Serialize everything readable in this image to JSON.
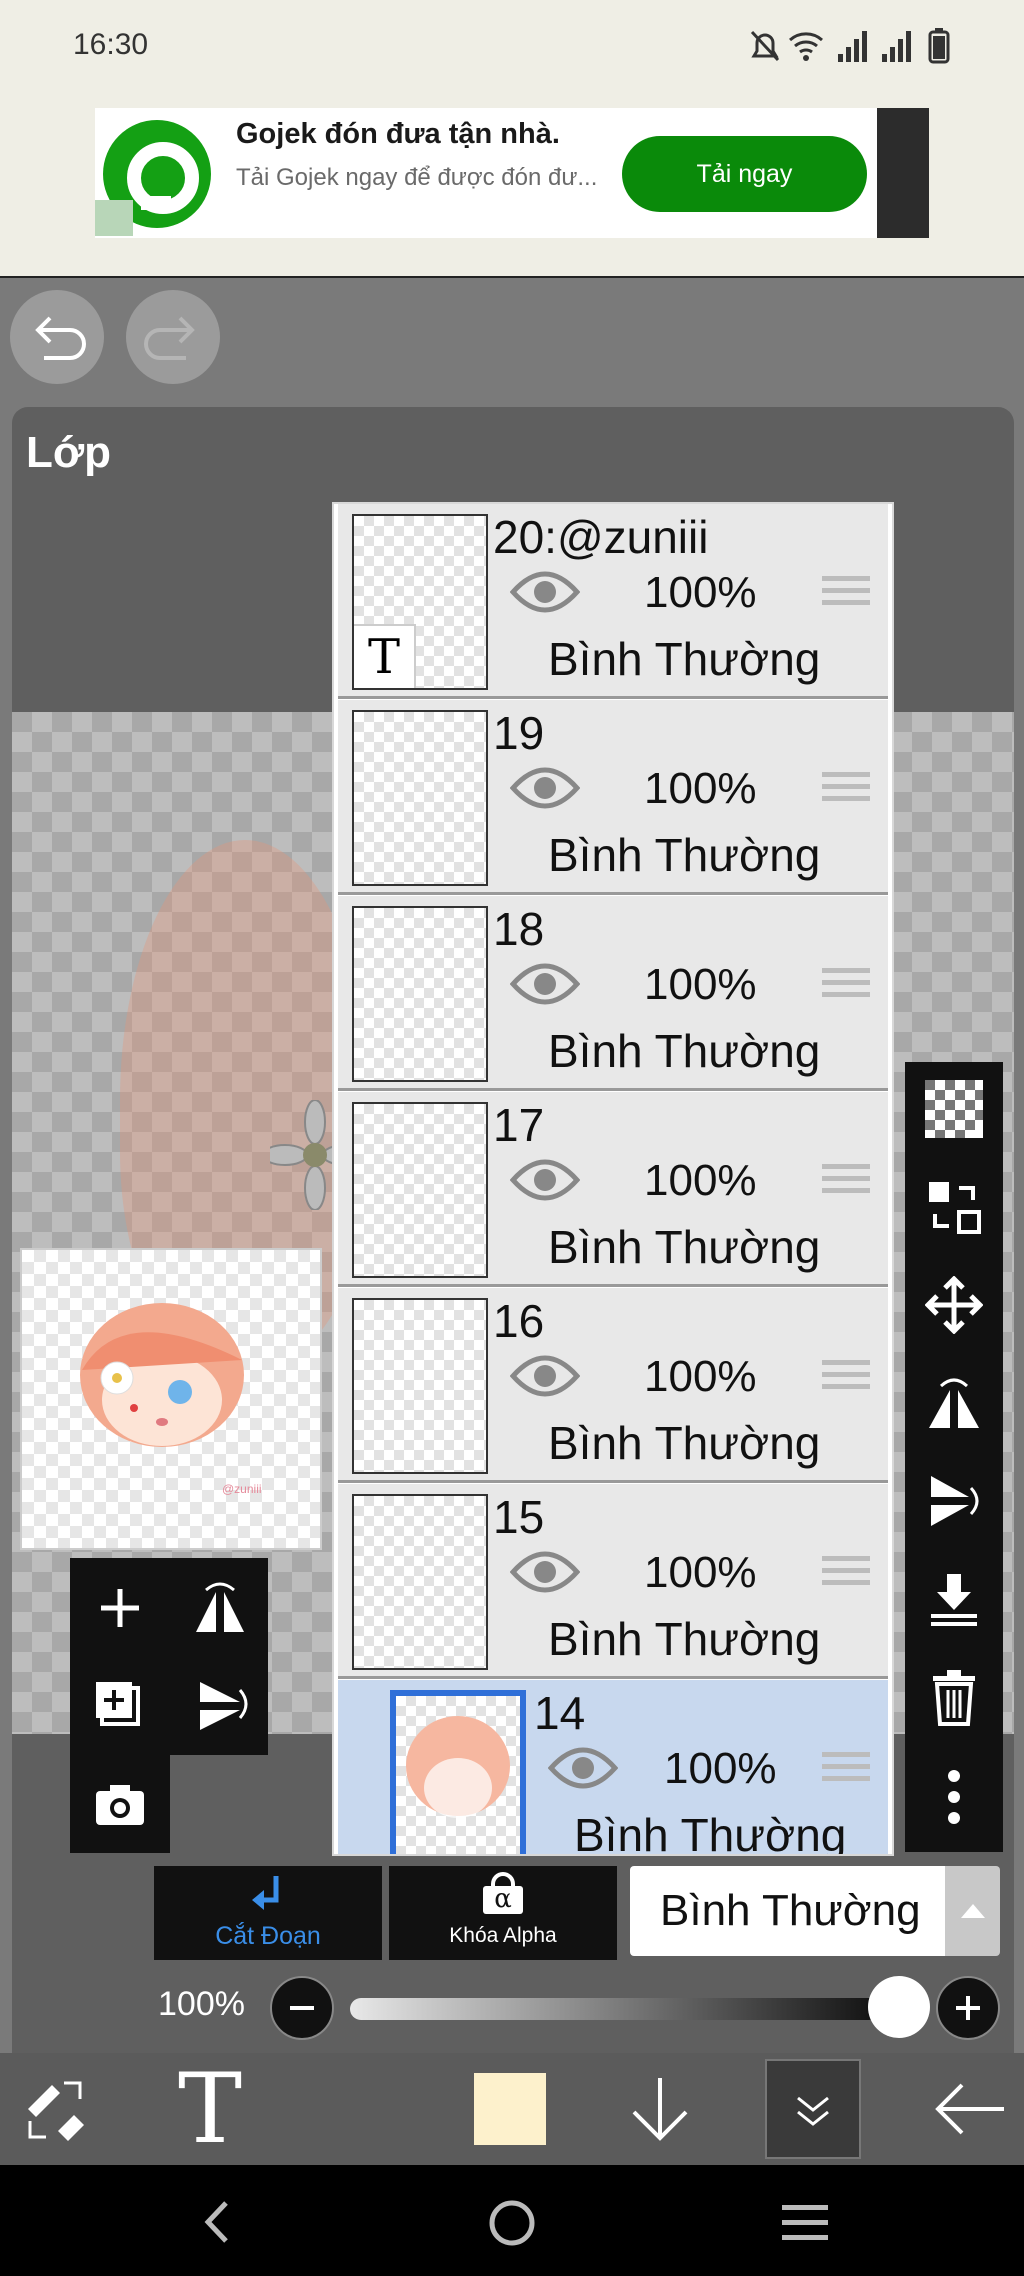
{
  "status": {
    "time": "16:30",
    "icons": [
      "bell-off-icon",
      "wifi-icon",
      "signal-icon",
      "signal-icon",
      "battery-icon"
    ]
  },
  "ad": {
    "title": "Gojek đón đưa tận nhà.",
    "subtitle": "Tải Gojek ngay để được đón đư...",
    "cta": "Tải ngay",
    "brand_color": "#14a014"
  },
  "history": {
    "undo_icon": "undo-icon",
    "redo_icon": "redo-icon"
  },
  "panel": {
    "title": "Lớp"
  },
  "preview": {
    "caption": "@zuniii"
  },
  "layers": [
    {
      "name": "20:@zuniii",
      "opacity": "100%",
      "blend": "Bình Thường",
      "is_text": true,
      "selected": false
    },
    {
      "name": "19",
      "opacity": "100%",
      "blend": "Bình Thường",
      "selected": false
    },
    {
      "name": "18",
      "opacity": "100%",
      "blend": "Bình Thường",
      "selected": false
    },
    {
      "name": "17",
      "opacity": "100%",
      "blend": "Bình Thường",
      "selected": false
    },
    {
      "name": "16",
      "opacity": "100%",
      "blend": "Bình Thường",
      "selected": false
    },
    {
      "name": "15",
      "opacity": "100%",
      "blend": "Bình Thường",
      "selected": false
    },
    {
      "name": "14",
      "opacity": "100%",
      "blend": "Bình Thường",
      "selected": true
    }
  ],
  "layer_text_badge": "T",
  "left_tools": [
    "add-layer-icon",
    "flip-horizontal-icon",
    "add-copy-icon",
    "flip-vertical-icon",
    "camera-icon"
  ],
  "right_tools": [
    "checker-icon",
    "transform-icon",
    "move-icon",
    "flip-h-icon",
    "flip-v-icon",
    "merge-down-icon",
    "trash-icon",
    "more-icon"
  ],
  "controls": {
    "cut_label": "Cắt Đoạn",
    "alpha_label": "Khóa Alpha",
    "alpha_symbol": "α",
    "blend_mode": "Bình Thường",
    "opacity_label": "100%",
    "opacity_value": 100,
    "accent": "#3a8ee8"
  },
  "bottom_toolbar": {
    "tools": [
      "brush-eraser-swap-icon",
      "text-tool-icon",
      "color-swatch",
      "arrow-down-icon",
      "layers-collapse-icon",
      "back-arrow-icon"
    ],
    "text_glyph": "T",
    "swatch_color": "#fdf1cc"
  }
}
